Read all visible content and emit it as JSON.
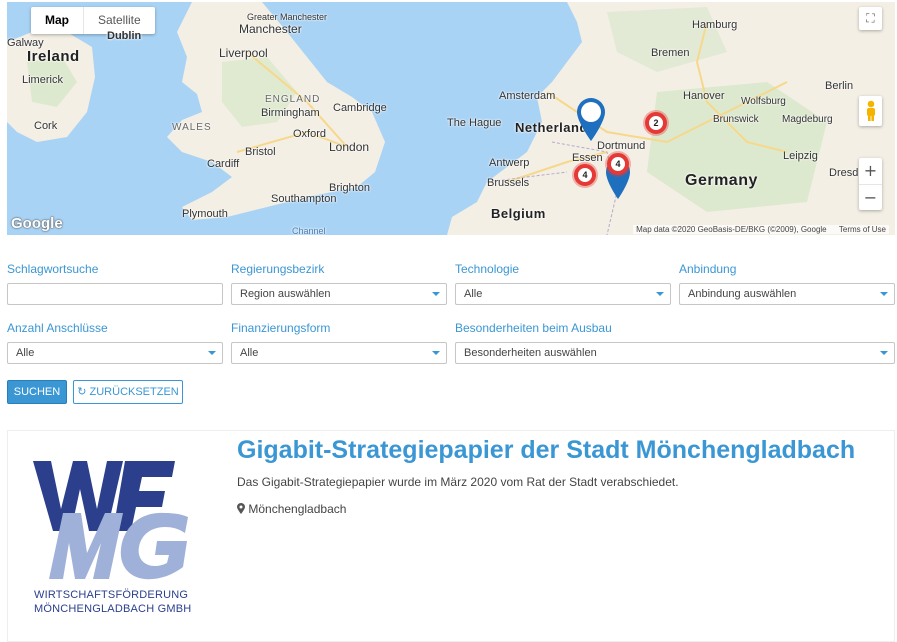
{
  "map": {
    "type_buttons": [
      "Map",
      "Satellite"
    ],
    "active_type": "Map",
    "labels": {
      "ireland": "Ireland",
      "galway": "Galway",
      "dublin": "Dublin",
      "limerick": "Limerick",
      "cork": "Cork",
      "manchester": "Manchester",
      "greater_manchester": "Greater Manchester",
      "liverpool": "Liverpool",
      "england": "ENGLAND",
      "wales": "WALES",
      "cambridge": "Cambridge",
      "birmingham": "Birmingham",
      "oxford": "Oxford",
      "cardiff": "Cardiff",
      "bristol": "Bristol",
      "london": "London",
      "brighton": "Brighton",
      "southampton": "Southampton",
      "plymouth": "Plymouth",
      "channel": "Channel",
      "amsterdam": "Amsterdam",
      "the_hague": "The Hague",
      "netherlands": "Netherlands",
      "antwerp": "Antwerp",
      "brussels": "Brussels",
      "belgium": "Belgium",
      "essen": "Essen",
      "dortmund": "Dortmund",
      "hamburg": "Hamburg",
      "bremen": "Bremen",
      "hanover": "Hanover",
      "wolfsburg": "Wolfsburg",
      "brunswick": "Brunswick",
      "magdeburg": "Magdeburg",
      "berlin": "Berlin",
      "leipzig": "Leipzig",
      "dresden": "Dresd",
      "germany": "Germany"
    },
    "clusters": [
      {
        "count": "2"
      },
      {
        "count": "4"
      },
      {
        "count": "4"
      }
    ],
    "attribution": "Map data ©2020 GeoBasis-DE/BKG (©2009), Google",
    "terms": "Terms of Use",
    "google": "Google",
    "zoom_in": "+",
    "zoom_out": "−",
    "fullscreen": "⛶",
    "colors": {
      "water": "#a9d3f5",
      "land": "#f3efe5",
      "green": "#cfe5c0",
      "road": "#f7d88a",
      "cluster": "#e53935",
      "pin": "#1f6fbf"
    }
  },
  "filters": {
    "keyword": {
      "label": "Schlagwortsuche",
      "value": ""
    },
    "district": {
      "label": "Regierungsbezirk",
      "value": "Region auswählen"
    },
    "technology": {
      "label": "Technologie",
      "value": "Alle"
    },
    "connection": {
      "label": "Anbindung",
      "value": "Anbindung auswählen"
    },
    "count": {
      "label": "Anzahl Anschlüsse",
      "value": "Alle"
    },
    "financing": {
      "label": "Finanzierungsform",
      "value": "Alle"
    },
    "special": {
      "label": "Besonderheiten beim Ausbau",
      "value": "Besonderheiten auswählen"
    }
  },
  "buttons": {
    "search": "SUCHEN",
    "reset": "ZURÜCKSETZEN",
    "reset_icon": "↻"
  },
  "result": {
    "title": "Gigabit-Strategiepapier der Stadt Mönchengladbach",
    "description": "Das Gigabit-Strategiepapier wurde im März 2020 vom Rat der Stadt verabschiedet.",
    "location": "Mönchengladbach",
    "location_icon": "map-marker-icon",
    "logo": {
      "line1": "WIRTSCHAFTSFÖRDERUNG",
      "line2": "MÖNCHENGLADBACH GMBH",
      "letters_top": "WF",
      "letters_bottom": "MG",
      "color_dark": "#2b3f8c",
      "color_light": "#9fb0d9"
    }
  }
}
